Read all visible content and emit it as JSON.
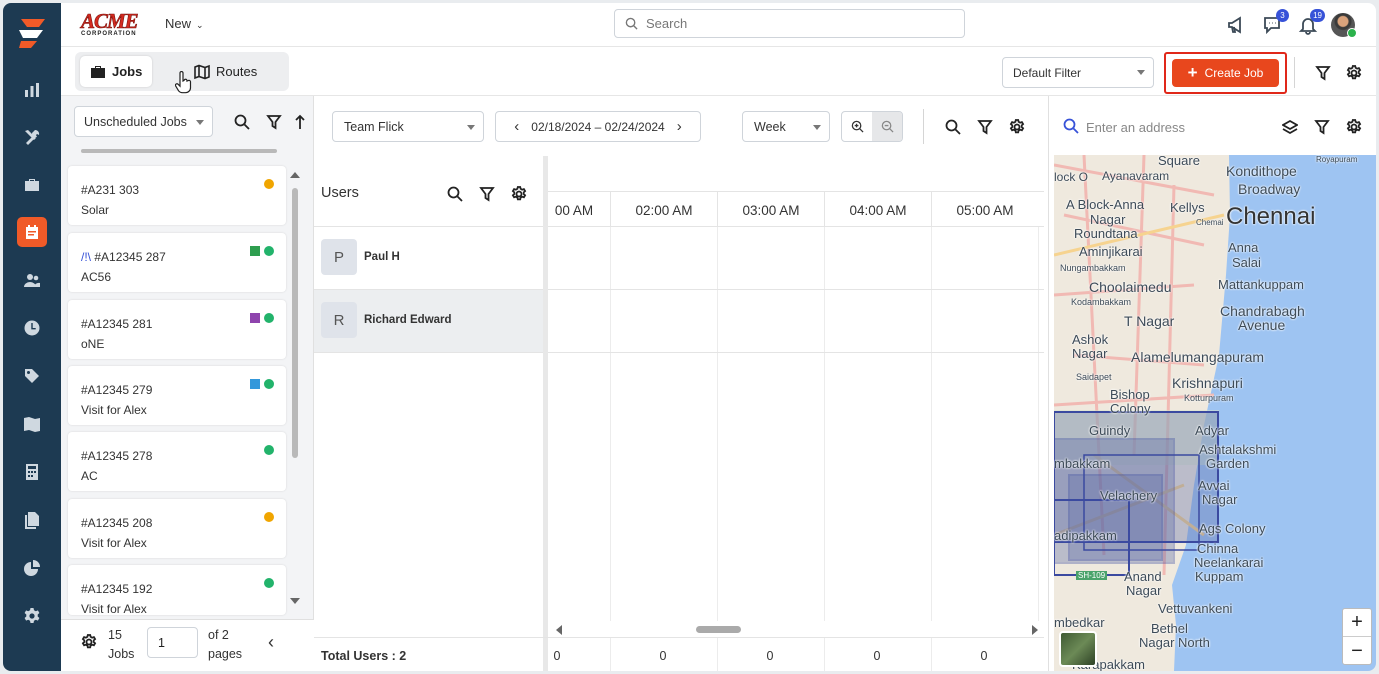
{
  "brand": {
    "name": "ACME",
    "sub": "CORPORATION"
  },
  "topbar": {
    "new_label": "New",
    "search_placeholder": "Search",
    "chat_badge": "3",
    "notif_badge": "19"
  },
  "tabs": [
    {
      "label": "Jobs",
      "icon": "briefcase-icon",
      "active": true
    },
    {
      "label": "Routes",
      "icon": "map-icon",
      "active": false
    }
  ],
  "toolbar": {
    "default_filter": "Default Filter",
    "create_job": "Create Job"
  },
  "jobs_panel": {
    "filter": "Unscheduled Jobs",
    "jobs": [
      {
        "id": "#A231 303",
        "subtitle": "Solar",
        "markers": [
          "#f0a500"
        ]
      },
      {
        "id": "#A12345 287",
        "prefix": "/!\\",
        "subtitle": "AC56",
        "markers": [
          "#2e9e4f",
          "#22b36b"
        ]
      },
      {
        "id": "#A12345 281",
        "subtitle": "oNE",
        "markers": [
          "#8e44ad",
          "#22b36b"
        ]
      },
      {
        "id": "#A12345 279",
        "subtitle": "Visit for Alex",
        "markers": [
          "#3498db",
          "#22b36b"
        ]
      },
      {
        "id": "#A12345 278",
        "subtitle": "AC",
        "markers": [
          "#22b36b"
        ]
      },
      {
        "id": "#A12345 208",
        "subtitle": "Visit for Alex",
        "markers": [
          "#f0a500"
        ]
      },
      {
        "id": "#A12345 192",
        "subtitle": "Visit for Alex",
        "markers": [
          "#22b36b"
        ]
      }
    ],
    "footer": {
      "count": "15",
      "count_label": "Jobs",
      "page": "1",
      "of": "of 2",
      "pages": "pages"
    }
  },
  "scheduler": {
    "team": "Team Flick",
    "date_range": "02/18/2024 – 02/24/2024",
    "view": "Week",
    "users_header": "Users",
    "users": [
      {
        "initial": "P",
        "name": "Paul H"
      },
      {
        "initial": "R",
        "name": "Richard Edward"
      }
    ],
    "time_columns": [
      "00 AM",
      "02:00 AM",
      "03:00 AM",
      "04:00 AM",
      "05:00 AM"
    ],
    "total_users": "Total Users : 2",
    "column_totals": [
      "0",
      "0",
      "0",
      "0",
      "0"
    ]
  },
  "map": {
    "address_placeholder": "Enter an address",
    "labels": [
      "Square",
      "Kondithope",
      "lock O",
      "Ayanavaram",
      "Broadway",
      "A Block-Anna",
      "Nagar",
      "Kellys",
      "Chennai",
      "Roundtana",
      "Aminjikarai",
      "Anna",
      "Salai",
      "Nungambakkam",
      "Choolaimedu",
      "Mattankuppam",
      "Kodambakkam",
      "T Nagar",
      "Chandrabagh",
      "Avenue",
      "Ashok",
      "Nagar",
      "Alamelumangapuram",
      "Saidapet",
      "Krishnapuri",
      "Bishop",
      "Colony",
      "Kotturpuram",
      "Guindy",
      "Adyar",
      "Ashtalakshmi",
      "Garden",
      "mbakkam",
      "Velachery",
      "Avvai",
      "Nagar",
      "adipakkam",
      "Ags Colony",
      "Chinna",
      "Neelankarai",
      "Kuppam",
      "Anand",
      "Nagar",
      "Vettuvankeni",
      "mbedkar",
      "Bethel",
      "Nagar North",
      "Karapakkam",
      "Royapuram",
      "Chemai",
      "SH-109"
    ],
    "zoom_in": "+",
    "zoom_out": "−"
  }
}
